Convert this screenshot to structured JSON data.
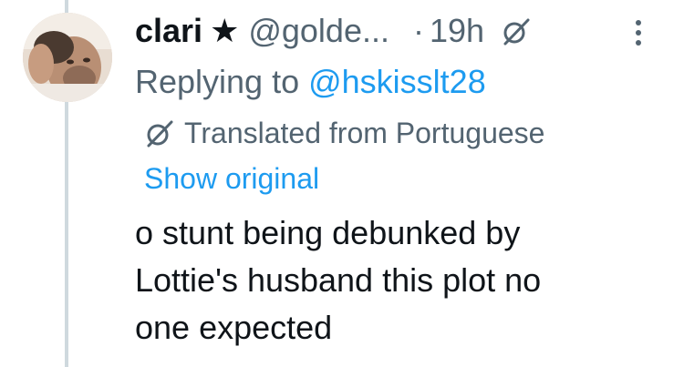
{
  "tweet": {
    "display_name": "clari",
    "badge_symbol": "★",
    "handle": "@golde...",
    "separator": "·",
    "time": "19h",
    "replying_prefix": "Replying to ",
    "replying_to": "@hskisslt28",
    "translation_notice": "Translated from Portuguese",
    "show_original_label": "Show original",
    "text_lines": [
      "o stunt being debunked by",
      "Lottie's husband this plot no",
      "one expected"
    ]
  },
  "icons": {
    "avatar": "avatar-photo",
    "grok": "grok-icon",
    "more": "more-vertical-icon",
    "translate": "translate-icon"
  },
  "colors": {
    "text_primary": "#0f1419",
    "text_secondary": "#536471",
    "link": "#1d9bf0",
    "thread_line": "#cfd9de"
  }
}
